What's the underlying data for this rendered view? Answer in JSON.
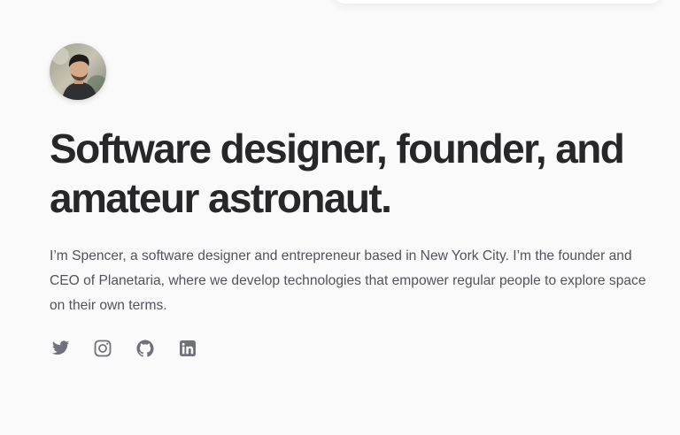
{
  "profile": {
    "avatar_alt": "Spencer portrait"
  },
  "hero": {
    "headline": "Software designer, founder, and amateur astronaut.",
    "bio": "I’m Spencer, a software designer and entrepreneur based in New York City. I’m the founder and CEO of Planetaria, where we develop technologies that empower regular people to explore space on their own terms."
  },
  "social_links": [
    {
      "icon": "twitter-icon"
    },
    {
      "icon": "instagram-icon"
    },
    {
      "icon": "github-icon"
    },
    {
      "icon": "linkedin-icon"
    }
  ],
  "colors": {
    "background": "#fafafa",
    "headline": "#27272a",
    "body_text": "#52525b",
    "icon": "#71717a"
  }
}
